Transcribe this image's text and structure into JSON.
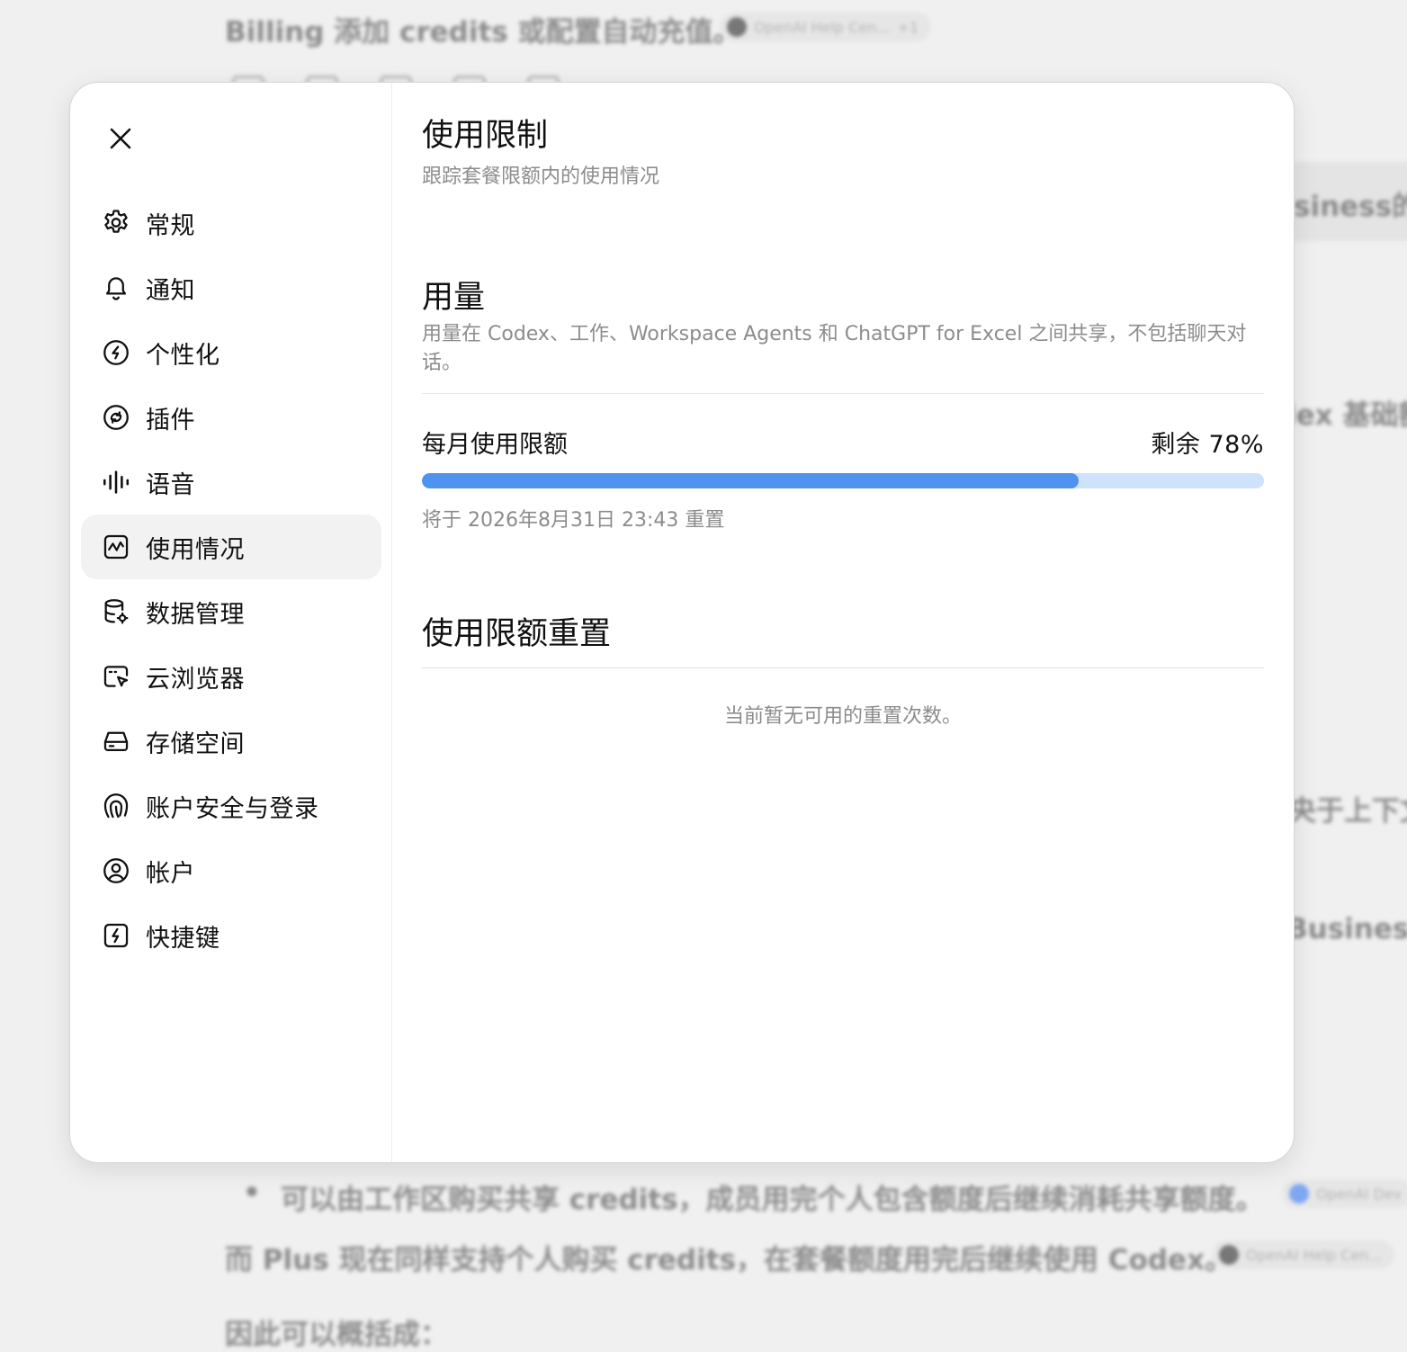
{
  "background": {
    "top_line": "Billing 添加 credits 或配置自动充值。",
    "citation_1": "OpenAI Help Cen...",
    "citation_1_extra": "+1",
    "right_fragment_1": "siness的",
    "right_fragment_2": "lex 基础额",
    "right_fragment_3": "央于上下文",
    "right_fragment_4": "Business",
    "bullet": "•",
    "bullet_text": "可以由工作区购买共享 credits，成员用完个人包含额度后继续消耗共享额度。",
    "citation_2": "OpenAI Dev",
    "plus_line": "而 Plus 现在同样支持个人购买 credits，在套餐额度用完后继续使用 Codex。",
    "citation_3": "OpenAI Help Cen...",
    "summary_line": "因此可以概括成："
  },
  "sidebar": {
    "close_icon": "close-icon",
    "items": [
      {
        "label": "常规",
        "icon": "gear-icon"
      },
      {
        "label": "通知",
        "icon": "bell-icon"
      },
      {
        "label": "个性化",
        "icon": "personalize-icon"
      },
      {
        "label": "插件",
        "icon": "plugin-icon"
      },
      {
        "label": "语音",
        "icon": "waveform-icon"
      },
      {
        "label": "使用情况",
        "icon": "usage-chart-icon",
        "active": true
      },
      {
        "label": "数据管理",
        "icon": "database-gear-icon"
      },
      {
        "label": "云浏览器",
        "icon": "cloud-browser-icon"
      },
      {
        "label": "存储空间",
        "icon": "storage-icon"
      },
      {
        "label": "账户安全与登录",
        "icon": "security-icon"
      },
      {
        "label": "帐户",
        "icon": "account-icon"
      },
      {
        "label": "快捷键",
        "icon": "shortcut-icon"
      }
    ]
  },
  "content": {
    "title": "使用限制",
    "subtitle": "跟踪套餐限额内的使用情况",
    "usage": {
      "title": "用量",
      "description": "用量在 Codex、工作、Workspace Agents 和 ChatGPT for Excel 之间共享，不包括聊天对话。",
      "monthly_label": "每月使用限额",
      "remaining_text": "剩余 78%",
      "used_fraction": 0.78,
      "reset_note": "将于 2026年8月31日 23:43 重置"
    },
    "reset": {
      "title": "使用限额重置",
      "empty_text": "当前暂无可用的重置次数。"
    }
  },
  "colors": {
    "progress_fill": "#4f93ee",
    "progress_track": "#cfe2fb",
    "active_nav_bg": "#f2f2f2"
  }
}
